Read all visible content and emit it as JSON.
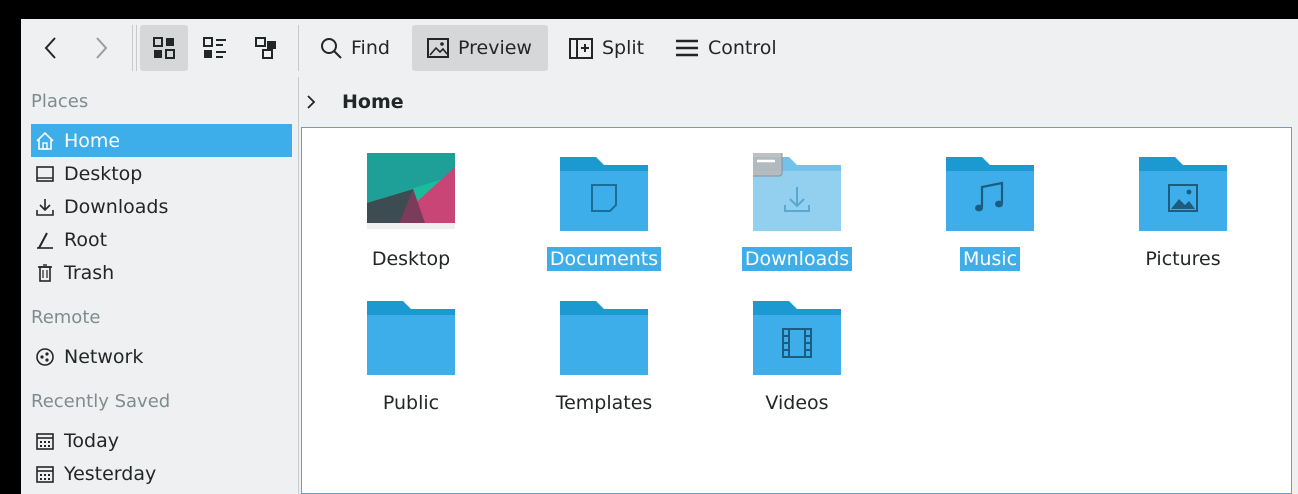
{
  "toolbar": {
    "back_icon": "chevron-left-icon",
    "forward_icon": "chevron-right-icon",
    "view_modes": [
      "icons-view-icon",
      "compact-view-icon",
      "details-view-icon"
    ],
    "find_label": "Find",
    "preview_label": "Preview",
    "split_label": "Split",
    "control_label": "Control"
  },
  "sidebar": {
    "places_heading": "Places",
    "places": [
      {
        "label": "Home",
        "icon": "home-icon",
        "selected": true
      },
      {
        "label": "Desktop",
        "icon": "desktop-icon"
      },
      {
        "label": "Downloads",
        "icon": "download-icon"
      },
      {
        "label": "Root",
        "icon": "root-icon"
      },
      {
        "label": "Trash",
        "icon": "trash-icon"
      }
    ],
    "remote_heading": "Remote",
    "remote": [
      {
        "label": "Network",
        "icon": "network-icon"
      }
    ],
    "recent_heading": "Recently Saved",
    "recent": [
      {
        "label": "Today",
        "icon": "calendar-icon"
      },
      {
        "label": "Yesterday",
        "icon": "calendar-icon"
      }
    ]
  },
  "breadcrumb": {
    "current": "Home"
  },
  "files": [
    {
      "name": "Desktop",
      "kind": "desktop-wallpaper",
      "selected": false
    },
    {
      "name": "Documents",
      "kind": "folder-documents",
      "selected": true
    },
    {
      "name": "Downloads",
      "kind": "folder-downloads",
      "selected": true
    },
    {
      "name": "Music",
      "kind": "folder-music",
      "selected": true
    },
    {
      "name": "Pictures",
      "kind": "folder-pictures",
      "selected": false
    },
    {
      "name": "Public",
      "kind": "folder",
      "selected": false
    },
    {
      "name": "Templates",
      "kind": "folder",
      "selected": false
    },
    {
      "name": "Videos",
      "kind": "folder-videos",
      "selected": false
    }
  ],
  "colors": {
    "accent": "#3daee9",
    "folder": "#3daee9",
    "folder_tab": "#1d99d2",
    "folder_hover": "#93cfee"
  }
}
